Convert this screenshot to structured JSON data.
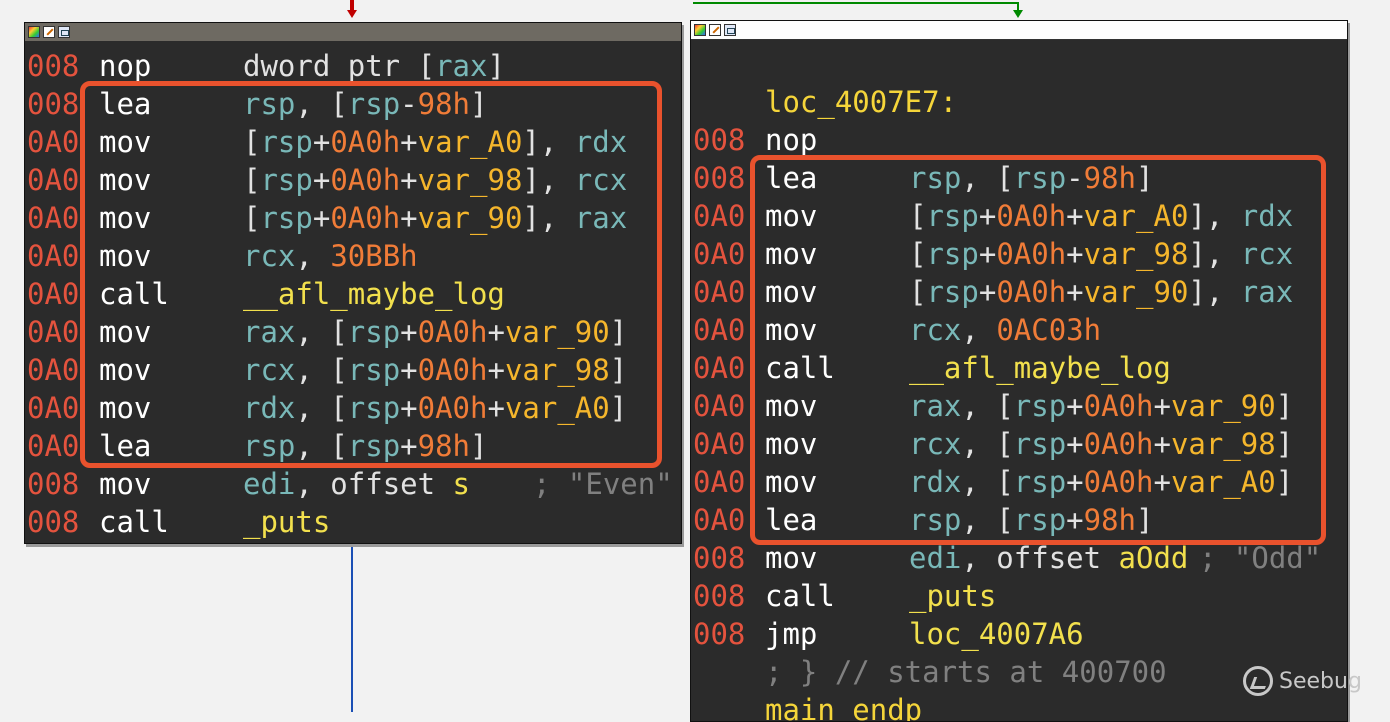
{
  "edge_colors": {
    "left": "#c00000",
    "right": "#008a00",
    "down": "#1b4fb5"
  },
  "left_block": {
    "lines": [
      {
        "sp": "008",
        "mn": "nop",
        "op": [
          {
            "t": "dword ptr ",
            "c": "p"
          },
          {
            "t": "[",
            "c": "p"
          },
          {
            "t": "rax",
            "c": "reg"
          },
          {
            "t": "]",
            "c": "p"
          }
        ]
      },
      {
        "sp": "008",
        "mn": "lea",
        "op": [
          {
            "t": "rsp",
            "c": "reg"
          },
          {
            "t": ", [",
            "c": "p"
          },
          {
            "t": "rsp",
            "c": "reg"
          },
          {
            "t": "-",
            "c": "p"
          },
          {
            "t": "98h",
            "c": "num"
          },
          {
            "t": "]",
            "c": "p"
          }
        ]
      },
      {
        "sp": "0A0",
        "mn": "mov",
        "op": [
          {
            "t": "[",
            "c": "p"
          },
          {
            "t": "rsp",
            "c": "reg"
          },
          {
            "t": "+",
            "c": "p"
          },
          {
            "t": "0A0h",
            "c": "num"
          },
          {
            "t": "+",
            "c": "p"
          },
          {
            "t": "var_A0",
            "c": "var"
          },
          {
            "t": "], ",
            "c": "p"
          },
          {
            "t": "rdx",
            "c": "reg"
          }
        ]
      },
      {
        "sp": "0A0",
        "mn": "mov",
        "op": [
          {
            "t": "[",
            "c": "p"
          },
          {
            "t": "rsp",
            "c": "reg"
          },
          {
            "t": "+",
            "c": "p"
          },
          {
            "t": "0A0h",
            "c": "num"
          },
          {
            "t": "+",
            "c": "p"
          },
          {
            "t": "var_98",
            "c": "var"
          },
          {
            "t": "], ",
            "c": "p"
          },
          {
            "t": "rcx",
            "c": "reg"
          }
        ]
      },
      {
        "sp": "0A0",
        "mn": "mov",
        "op": [
          {
            "t": "[",
            "c": "p"
          },
          {
            "t": "rsp",
            "c": "reg"
          },
          {
            "t": "+",
            "c": "p"
          },
          {
            "t": "0A0h",
            "c": "num"
          },
          {
            "t": "+",
            "c": "p"
          },
          {
            "t": "var_90",
            "c": "var"
          },
          {
            "t": "], ",
            "c": "p"
          },
          {
            "t": "rax",
            "c": "reg"
          }
        ]
      },
      {
        "sp": "0A0",
        "mn": "mov",
        "op": [
          {
            "t": "rcx",
            "c": "reg"
          },
          {
            "t": ", ",
            "c": "p"
          },
          {
            "t": "30BBh",
            "c": "num"
          }
        ]
      },
      {
        "sp": "0A0",
        "mn": "call",
        "op": [
          {
            "t": "__afl_maybe_log",
            "c": "sym"
          }
        ]
      },
      {
        "sp": "0A0",
        "mn": "mov",
        "op": [
          {
            "t": "rax",
            "c": "reg"
          },
          {
            "t": ", [",
            "c": "p"
          },
          {
            "t": "rsp",
            "c": "reg"
          },
          {
            "t": "+",
            "c": "p"
          },
          {
            "t": "0A0h",
            "c": "num"
          },
          {
            "t": "+",
            "c": "p"
          },
          {
            "t": "var_90",
            "c": "var"
          },
          {
            "t": "]",
            "c": "p"
          }
        ]
      },
      {
        "sp": "0A0",
        "mn": "mov",
        "op": [
          {
            "t": "rcx",
            "c": "reg"
          },
          {
            "t": ", [",
            "c": "p"
          },
          {
            "t": "rsp",
            "c": "reg"
          },
          {
            "t": "+",
            "c": "p"
          },
          {
            "t": "0A0h",
            "c": "num"
          },
          {
            "t": "+",
            "c": "p"
          },
          {
            "t": "var_98",
            "c": "var"
          },
          {
            "t": "]",
            "c": "p"
          }
        ]
      },
      {
        "sp": "0A0",
        "mn": "mov",
        "op": [
          {
            "t": "rdx",
            "c": "reg"
          },
          {
            "t": ", [",
            "c": "p"
          },
          {
            "t": "rsp",
            "c": "reg"
          },
          {
            "t": "+",
            "c": "p"
          },
          {
            "t": "0A0h",
            "c": "num"
          },
          {
            "t": "+",
            "c": "p"
          },
          {
            "t": "var_A0",
            "c": "var"
          },
          {
            "t": "]",
            "c": "p"
          }
        ]
      },
      {
        "sp": "0A0",
        "mn": "lea",
        "op": [
          {
            "t": "rsp",
            "c": "reg"
          },
          {
            "t": ", [",
            "c": "p"
          },
          {
            "t": "rsp",
            "c": "reg"
          },
          {
            "t": "+",
            "c": "p"
          },
          {
            "t": "98h",
            "c": "num"
          },
          {
            "t": "]",
            "c": "p"
          }
        ]
      },
      {
        "sp": "008",
        "mn": "mov",
        "op": [
          {
            "t": "edi",
            "c": "reg"
          },
          {
            "t": ", offset ",
            "c": "p"
          },
          {
            "t": "s",
            "c": "sym"
          }
        ],
        "comment": "; \"Even\""
      },
      {
        "sp": "008",
        "mn": "call",
        "op": [
          {
            "t": "_puts",
            "c": "sym"
          }
        ]
      }
    ]
  },
  "right_block": {
    "label": "loc_4007E7:",
    "lines": [
      {
        "sp": "008",
        "mn": "nop",
        "op": []
      },
      {
        "sp": "008",
        "mn": "lea",
        "op": [
          {
            "t": "rsp",
            "c": "reg"
          },
          {
            "t": ", [",
            "c": "p"
          },
          {
            "t": "rsp",
            "c": "reg"
          },
          {
            "t": "-",
            "c": "p"
          },
          {
            "t": "98h",
            "c": "num"
          },
          {
            "t": "]",
            "c": "p"
          }
        ]
      },
      {
        "sp": "0A0",
        "mn": "mov",
        "op": [
          {
            "t": "[",
            "c": "p"
          },
          {
            "t": "rsp",
            "c": "reg"
          },
          {
            "t": "+",
            "c": "p"
          },
          {
            "t": "0A0h",
            "c": "num"
          },
          {
            "t": "+",
            "c": "p"
          },
          {
            "t": "var_A0",
            "c": "var"
          },
          {
            "t": "], ",
            "c": "p"
          },
          {
            "t": "rdx",
            "c": "reg"
          }
        ]
      },
      {
        "sp": "0A0",
        "mn": "mov",
        "op": [
          {
            "t": "[",
            "c": "p"
          },
          {
            "t": "rsp",
            "c": "reg"
          },
          {
            "t": "+",
            "c": "p"
          },
          {
            "t": "0A0h",
            "c": "num"
          },
          {
            "t": "+",
            "c": "p"
          },
          {
            "t": "var_98",
            "c": "var"
          },
          {
            "t": "], ",
            "c": "p"
          },
          {
            "t": "rcx",
            "c": "reg"
          }
        ]
      },
      {
        "sp": "0A0",
        "mn": "mov",
        "op": [
          {
            "t": "[",
            "c": "p"
          },
          {
            "t": "rsp",
            "c": "reg"
          },
          {
            "t": "+",
            "c": "p"
          },
          {
            "t": "0A0h",
            "c": "num"
          },
          {
            "t": "+",
            "c": "p"
          },
          {
            "t": "var_90",
            "c": "var"
          },
          {
            "t": "], ",
            "c": "p"
          },
          {
            "t": "rax",
            "c": "reg"
          }
        ]
      },
      {
        "sp": "0A0",
        "mn": "mov",
        "op": [
          {
            "t": "rcx",
            "c": "reg"
          },
          {
            "t": ", ",
            "c": "p"
          },
          {
            "t": "0AC03h",
            "c": "num"
          }
        ]
      },
      {
        "sp": "0A0",
        "mn": "call",
        "op": [
          {
            "t": "__afl_maybe_log",
            "c": "sym"
          }
        ]
      },
      {
        "sp": "0A0",
        "mn": "mov",
        "op": [
          {
            "t": "rax",
            "c": "reg"
          },
          {
            "t": ", [",
            "c": "p"
          },
          {
            "t": "rsp",
            "c": "reg"
          },
          {
            "t": "+",
            "c": "p"
          },
          {
            "t": "0A0h",
            "c": "num"
          },
          {
            "t": "+",
            "c": "p"
          },
          {
            "t": "var_90",
            "c": "var"
          },
          {
            "t": "]",
            "c": "p"
          }
        ]
      },
      {
        "sp": "0A0",
        "mn": "mov",
        "op": [
          {
            "t": "rcx",
            "c": "reg"
          },
          {
            "t": ", [",
            "c": "p"
          },
          {
            "t": "rsp",
            "c": "reg"
          },
          {
            "t": "+",
            "c": "p"
          },
          {
            "t": "0A0h",
            "c": "num"
          },
          {
            "t": "+",
            "c": "p"
          },
          {
            "t": "var_98",
            "c": "var"
          },
          {
            "t": "]",
            "c": "p"
          }
        ]
      },
      {
        "sp": "0A0",
        "mn": "mov",
        "op": [
          {
            "t": "rdx",
            "c": "reg"
          },
          {
            "t": ", [",
            "c": "p"
          },
          {
            "t": "rsp",
            "c": "reg"
          },
          {
            "t": "+",
            "c": "p"
          },
          {
            "t": "0A0h",
            "c": "num"
          },
          {
            "t": "+",
            "c": "p"
          },
          {
            "t": "var_A0",
            "c": "var"
          },
          {
            "t": "]",
            "c": "p"
          }
        ]
      },
      {
        "sp": "0A0",
        "mn": "lea",
        "op": [
          {
            "t": "rsp",
            "c": "reg"
          },
          {
            "t": ", [",
            "c": "p"
          },
          {
            "t": "rsp",
            "c": "reg"
          },
          {
            "t": "+",
            "c": "p"
          },
          {
            "t": "98h",
            "c": "num"
          },
          {
            "t": "]",
            "c": "p"
          }
        ]
      },
      {
        "sp": "008",
        "mn": "mov",
        "op": [
          {
            "t": "edi",
            "c": "reg"
          },
          {
            "t": ", offset ",
            "c": "p"
          },
          {
            "t": "aOdd",
            "c": "sym"
          }
        ],
        "comment": "; \"Odd\""
      },
      {
        "sp": "008",
        "mn": "call",
        "op": [
          {
            "t": "_puts",
            "c": "sym"
          }
        ]
      },
      {
        "sp": "008",
        "mn": "jmp",
        "op": [
          {
            "t": "loc_4007A6",
            "c": "sym"
          }
        ]
      }
    ],
    "footer_comment": "; } // starts at 400700",
    "endp": "main endp"
  },
  "watermark": {
    "text": "Seebug"
  }
}
